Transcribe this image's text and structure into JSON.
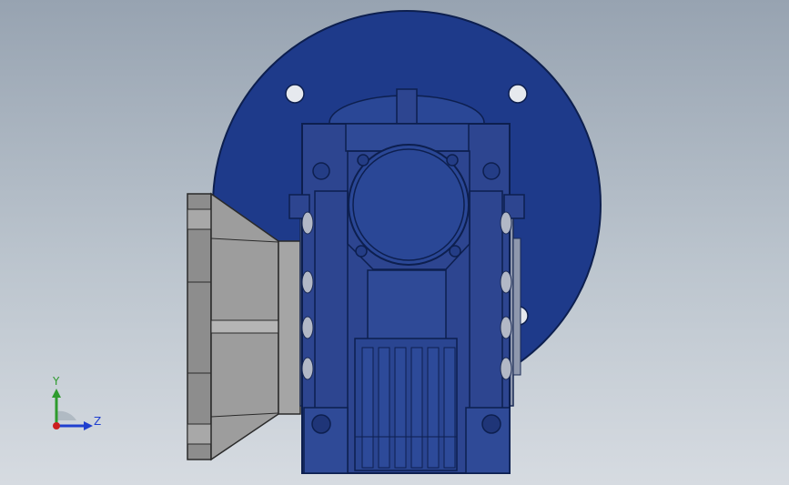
{
  "colors": {
    "background_top": "#97a3b1",
    "background_bottom": "#d6dbe1",
    "housing_blue": "#2d4590",
    "flange_blue": "#1e3a8a",
    "adapter_gray": "#9a9a9a",
    "axis_y": "#2e9b2e",
    "axis_z": "#1f3fcf",
    "axis_x": "#cc1f1f"
  },
  "triad": {
    "y_label": "Y",
    "z_label": "Z"
  }
}
